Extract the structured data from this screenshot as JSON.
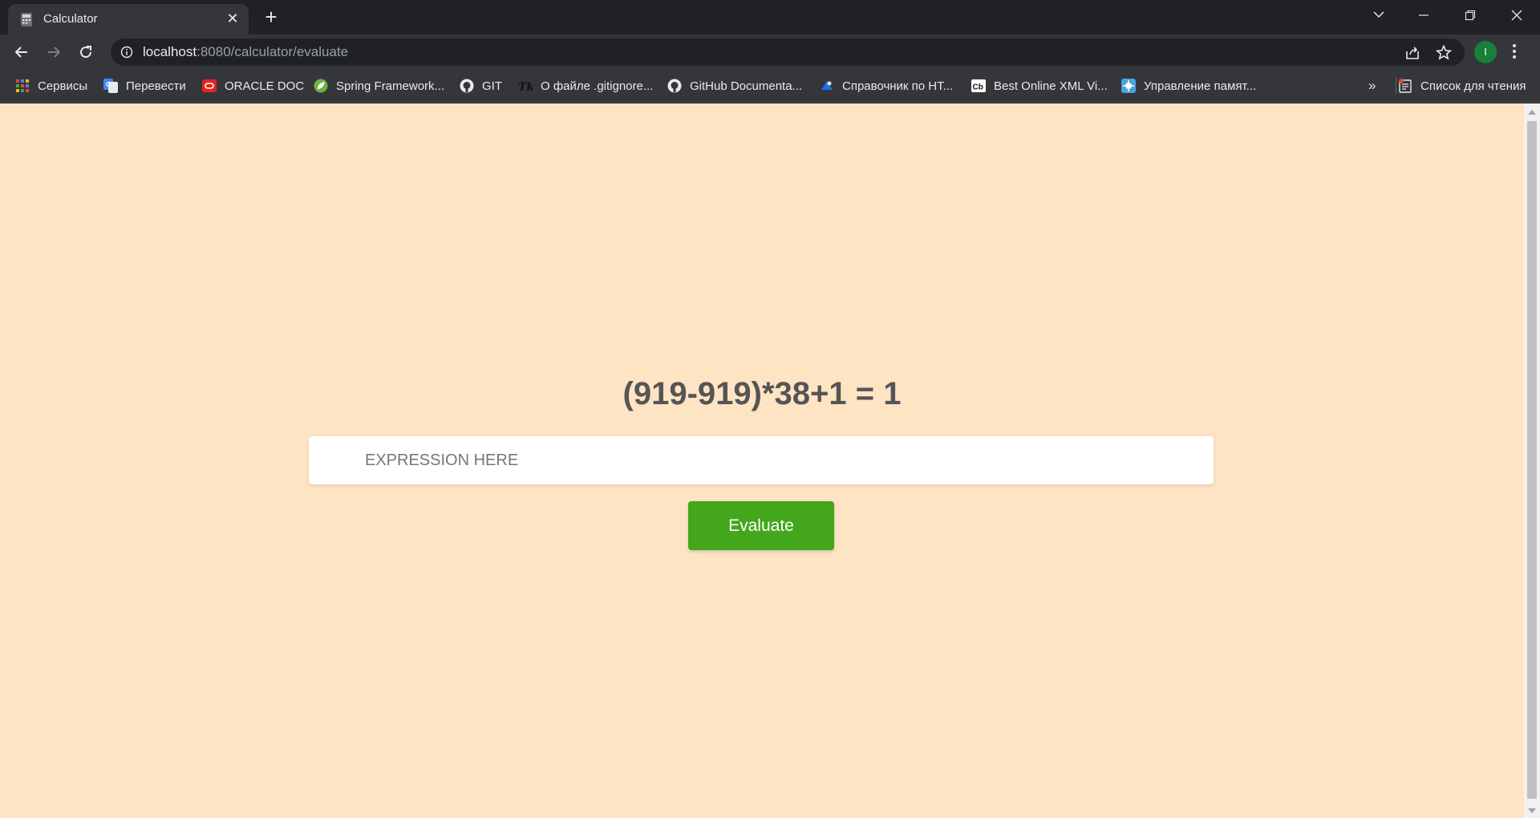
{
  "browser": {
    "tab": {
      "title": "Calculator",
      "favicon": "calculator-icon"
    },
    "address": {
      "host": "localhost",
      "rest": ":8080/calculator/evaluate"
    },
    "profile_initial": "I",
    "bookmarks": [
      {
        "label": "Сервисы",
        "icon": "apps-grid-icon"
      },
      {
        "label": "Перевести",
        "icon": "google-translate-icon"
      },
      {
        "label": "ORACLE DOC",
        "icon": "oracle-icon"
      },
      {
        "label": "Spring Framework...",
        "icon": "spring-leaf-icon"
      },
      {
        "label": "GIT",
        "icon": "github-icon"
      },
      {
        "label": "О файле .gitignore...",
        "icon": "tk-icon"
      },
      {
        "label": "GitHub Documenta...",
        "icon": "github-icon"
      },
      {
        "label": "Справочник по HT...",
        "icon": "htmlbook-icon"
      },
      {
        "label": "Best Online XML Vi...",
        "icon": "cb-icon"
      },
      {
        "label": "Управление памят...",
        "icon": "memory-icon"
      }
    ],
    "bookmarks_overflow": "»",
    "reading_list": "Список для чтения"
  },
  "page": {
    "result": "(919-919)*38+1 = 1",
    "input_placeholder": "EXPRESSION HERE",
    "input_value": "",
    "button_label": "Evaluate"
  },
  "colors": {
    "page_bg": "#ffe4c4",
    "button_bg": "#43a61b",
    "result_text": "#555555"
  }
}
